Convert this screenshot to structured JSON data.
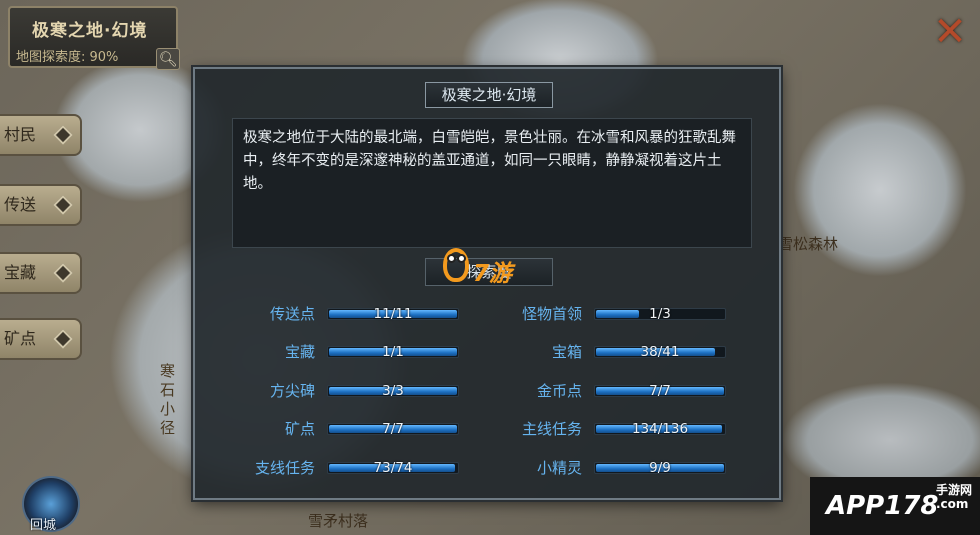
{
  "map": {
    "title": "极寒之地·幻境",
    "explore_rate": "地图探索度: 90%",
    "side_tabs": [
      "村民",
      "传送",
      "宝藏",
      "矿点"
    ],
    "labels": {
      "bottom": "雪矛村落",
      "right_forest": "雪松森林",
      "left_path": "寒石小径"
    },
    "back_label": "回城"
  },
  "watermark": {
    "text": "APP178",
    "sub": "手游网\n.com"
  },
  "dialog": {
    "title": "极寒之地·幻境",
    "description": "极寒之地位于大陆的最北端，白雪皑皑，景色壮丽。在冰雪和风暴的狂歌乱舞中，终年不变的是深邃神秘的盖亚通道，如同一只眼睛，静静凝视着这片土地。",
    "explore_title": "探索度",
    "overlay_logo": "7游",
    "stats_left": [
      {
        "label": "传送点",
        "value": "11/11",
        "progress": 1.0
      },
      {
        "label": "宝藏",
        "value": "1/1",
        "progress": 1.0
      },
      {
        "label": "方尖碑",
        "value": "3/3",
        "progress": 1.0
      },
      {
        "label": "矿点",
        "value": "7/7",
        "progress": 1.0
      },
      {
        "label": "支线任务",
        "value": "73/74",
        "progress": 0.986
      }
    ],
    "stats_right": [
      {
        "label": "怪物首领",
        "value": "1/3",
        "progress": 0.333
      },
      {
        "label": "宝箱",
        "value": "38/41",
        "progress": 0.927
      },
      {
        "label": "金币点",
        "value": "7/7",
        "progress": 1.0
      },
      {
        "label": "主线任务",
        "value": "134/136",
        "progress": 0.985
      },
      {
        "label": "小精灵",
        "value": "9/9",
        "progress": 1.0
      }
    ]
  },
  "colors": {
    "label_blue": "#66b4ef",
    "bar_fill": "#1c6fc2",
    "close_red": "#b44a2a"
  }
}
